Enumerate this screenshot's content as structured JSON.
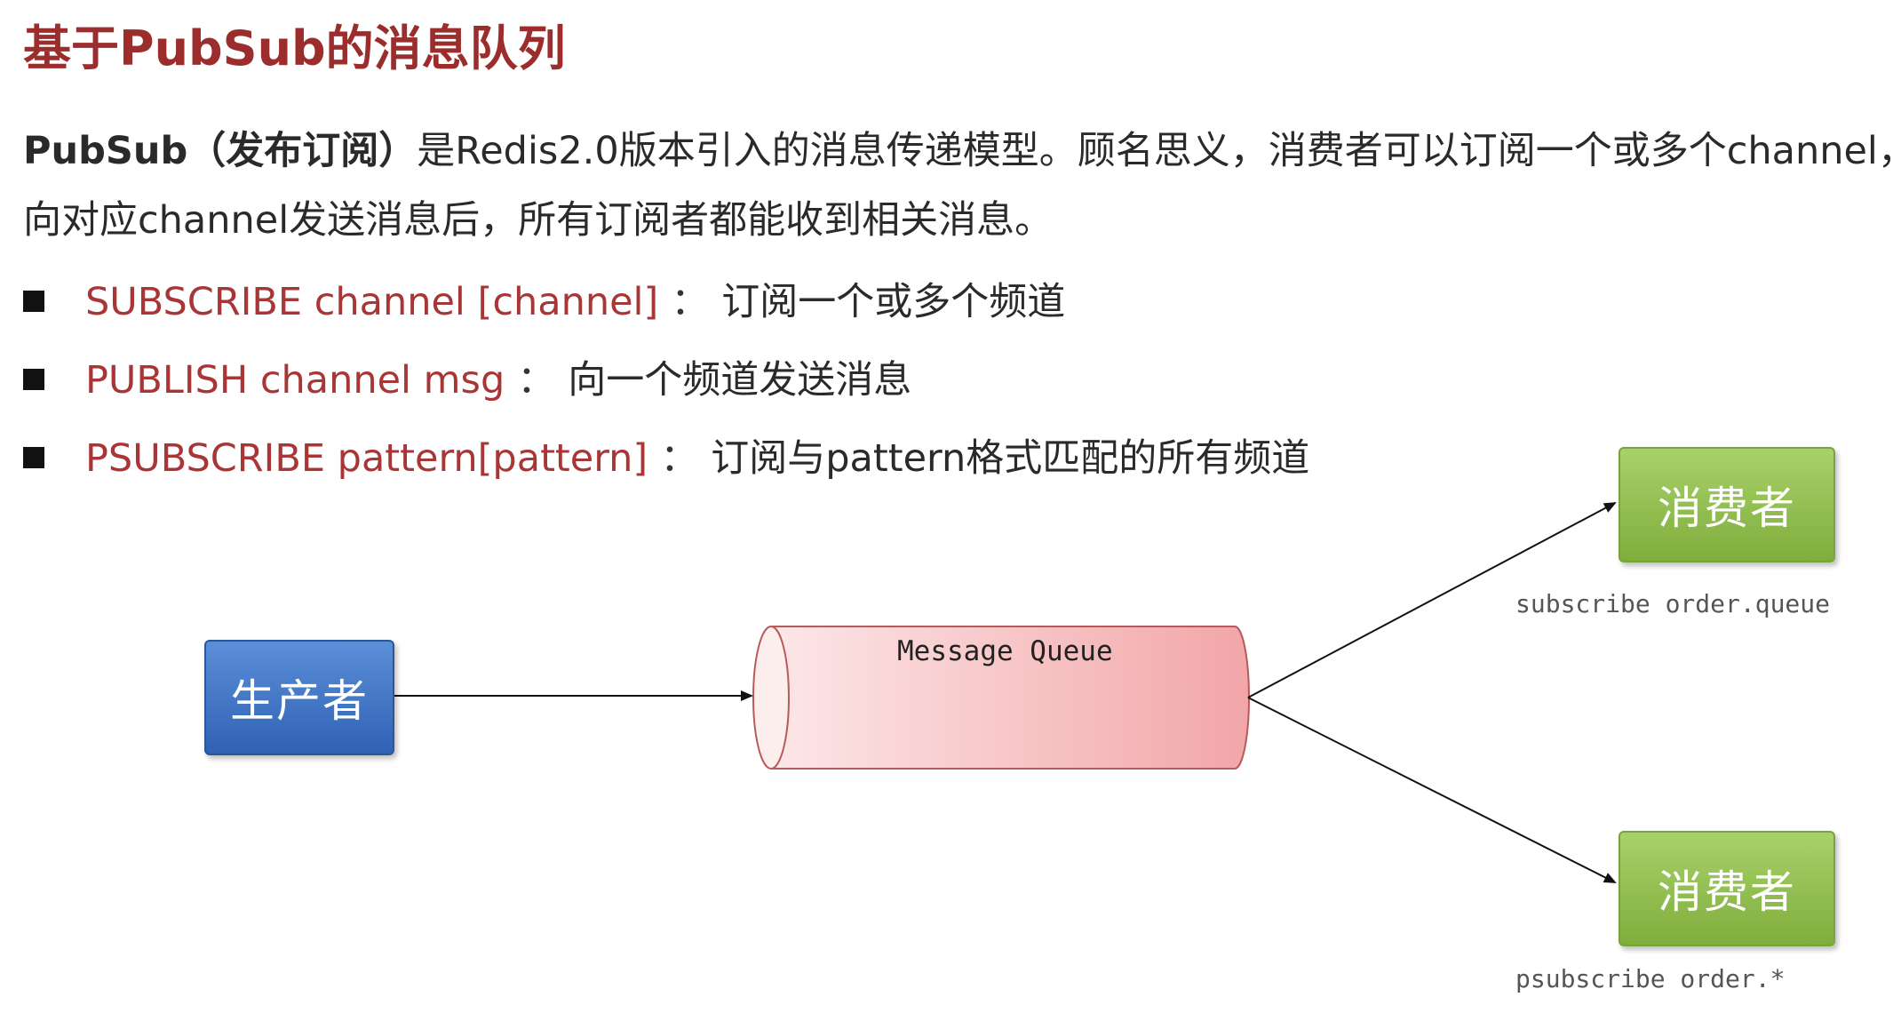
{
  "title": "基于PubSub的消息队列",
  "intro": {
    "lead": "PubSub（发布订阅）",
    "line1_rest": "是Redis2.0版本引入的消息传递模型。顾名思义，消费者可以订阅一个或多个channel，生",
    "line2": "向对应channel发送消息后，所有订阅者都能收到相关消息。"
  },
  "commands": [
    {
      "cmd": "SUBSCRIBE channel [channel]",
      "sep": "：",
      "desc": "订阅一个或多个频道"
    },
    {
      "cmd": "PUBLISH channel msg",
      "sep": "：",
      "desc": "向一个频道发送消息"
    },
    {
      "cmd": "PSUBSCRIBE pattern[pattern]",
      "sep": "：",
      "desc": "订阅与pattern格式匹配的所有频道"
    }
  ],
  "diagram": {
    "producer": "生产者",
    "queue": "Message Queue",
    "consumers": [
      {
        "label": "消费者",
        "subscription": "subscribe order.queue"
      },
      {
        "label": "消费者",
        "subscription": "psubscribe order.*"
      }
    ]
  },
  "colors": {
    "title": "#9b2d2d",
    "command": "#a93636",
    "producer": "#3a6fc0",
    "consumer": "#8fbf4a",
    "queue": "#f2a6a8"
  }
}
